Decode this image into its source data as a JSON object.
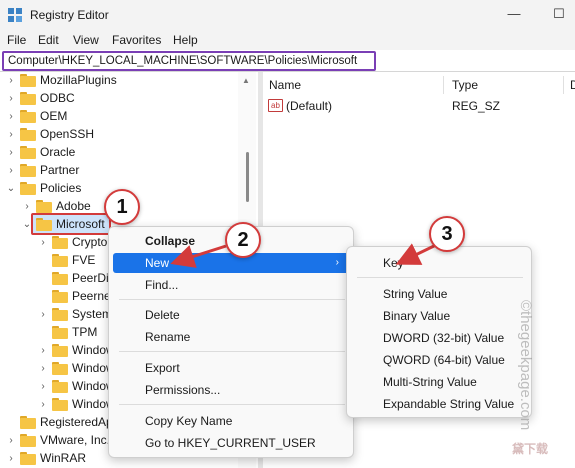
{
  "window": {
    "title": "Registry Editor",
    "controls": {
      "minimize": "—",
      "maximize": "☐"
    }
  },
  "menubar": {
    "items": [
      "File",
      "Edit",
      "View",
      "Favorites",
      "Help"
    ]
  },
  "address": {
    "path": "Computer\\HKEY_LOCAL_MACHINE\\SOFTWARE\\Policies\\Microsoft"
  },
  "tree": {
    "items": [
      {
        "label": "MozillaPlugins",
        "expander": "›"
      },
      {
        "label": "ODBC",
        "expander": "›"
      },
      {
        "label": "OEM",
        "expander": "›"
      },
      {
        "label": "OpenSSH",
        "expander": "›"
      },
      {
        "label": "Oracle",
        "expander": "›"
      },
      {
        "label": "Partner",
        "expander": "›"
      },
      {
        "label": "Policies",
        "expander": "⌄"
      },
      {
        "label": "Adobe",
        "expander": "›"
      },
      {
        "label": "Microsoft",
        "expander": "⌄",
        "selected": true
      },
      {
        "label": "Crypto",
        "expander": "›"
      },
      {
        "label": "FVE",
        "expander": ""
      },
      {
        "label": "PeerDis",
        "expander": ""
      },
      {
        "label": "Peerne",
        "expander": ""
      },
      {
        "label": "System",
        "expander": "›"
      },
      {
        "label": "TPM",
        "expander": ""
      },
      {
        "label": "Window",
        "expander": "›"
      },
      {
        "label": "Window",
        "expander": "›"
      },
      {
        "label": "Window",
        "expander": "›"
      },
      {
        "label": "Window",
        "expander": "›"
      },
      {
        "label": "RegisteredAp",
        "expander": ""
      },
      {
        "label": "VMware, Inc.",
        "expander": "›"
      },
      {
        "label": "WinRAR",
        "expander": "›"
      }
    ]
  },
  "list": {
    "columns": [
      "Name",
      "Type",
      "D"
    ],
    "rows": [
      {
        "icon": "ab",
        "name": "(Default)",
        "type": "REG_SZ"
      }
    ]
  },
  "context_menu": {
    "items": [
      {
        "label": "Collapse",
        "bold": true
      },
      {
        "label": "New",
        "active": true,
        "submenu_arrow": "›"
      },
      {
        "label": "Find..."
      },
      {
        "label": "Delete"
      },
      {
        "label": "Rename"
      },
      {
        "label": "Export"
      },
      {
        "label": "Permissions..."
      },
      {
        "label": "Copy Key Name"
      },
      {
        "label": "Go to HKEY_CURRENT_USER"
      }
    ]
  },
  "submenu": {
    "items": [
      "Key",
      "String Value",
      "Binary Value",
      "DWORD (32-bit) Value",
      "QWORD (64-bit) Value",
      "Multi-String Value",
      "Expandable String Value"
    ]
  },
  "callouts": [
    "1",
    "2",
    "3"
  ],
  "watermark": "©thegeekpage.com",
  "logo": "黛下载",
  "colors": {
    "highlight_border": "#d33b3b",
    "address_border": "#7a3fb5",
    "menu_active": "#1a73e8",
    "folder": "#f6c545"
  }
}
